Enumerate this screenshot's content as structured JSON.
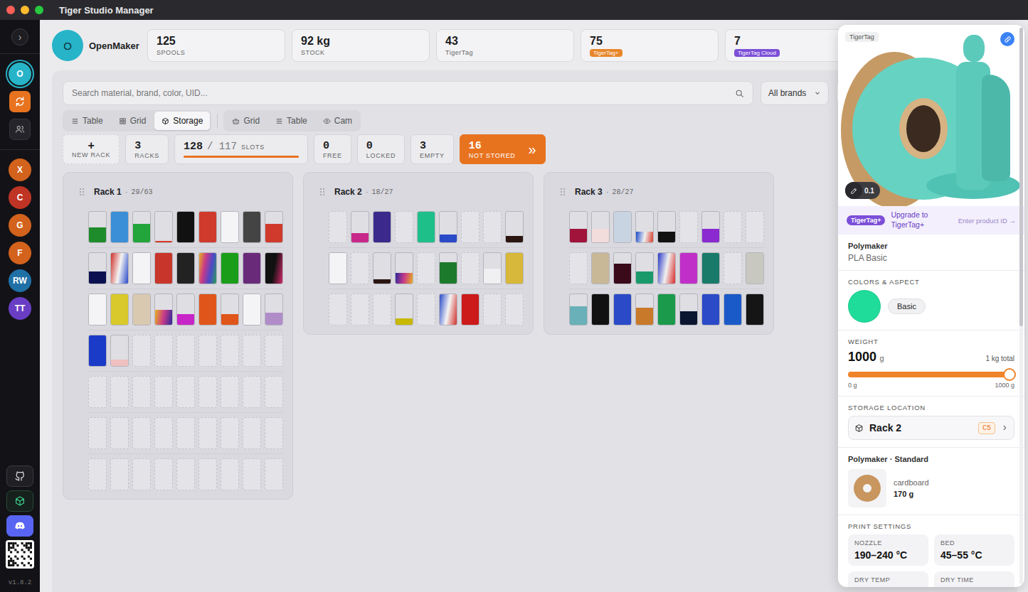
{
  "window": {
    "title": "Tiger Studio Manager"
  },
  "sidebar": {
    "toggle": "›",
    "top": [
      {
        "kind": "avatar",
        "label": "O",
        "color": "#27b3c8",
        "selected": true
      },
      {
        "kind": "sync",
        "color": "#e8731f",
        "selected": false
      },
      {
        "kind": "users",
        "selected": false
      }
    ],
    "accounts": [
      {
        "label": "X",
        "color": "#d2621c",
        "selected": false
      },
      {
        "label": "C",
        "color": "#bf3424",
        "selected": false
      },
      {
        "label": "G",
        "color": "#d2621c",
        "selected": false
      },
      {
        "label": "F",
        "color": "#d2621c",
        "selected": false
      },
      {
        "label": "RW",
        "color": "#1f70a6",
        "selected": false
      },
      {
        "label": "TT",
        "color": "#6a3ec4",
        "selected": false
      }
    ],
    "bottom": [
      {
        "kind": "github"
      },
      {
        "kind": "cube"
      },
      {
        "kind": "discord"
      },
      {
        "kind": "qr"
      }
    ],
    "version": "v1.8.2"
  },
  "header": {
    "avatar": "O",
    "name": "OpenMaker",
    "stats": [
      {
        "kind": "plain",
        "value": "125",
        "label": "SPOOLS"
      },
      {
        "kind": "plain",
        "value": "92 kg",
        "label": "STOCK"
      },
      {
        "kind": "plain",
        "value": "43",
        "label": "TigerTag"
      },
      {
        "kind": "badge",
        "value": "75",
        "label": "TigerTag+",
        "color": "#e8862a"
      },
      {
        "kind": "badge",
        "value": "7",
        "label": "TigerTag Cloud",
        "color": "#7c4fd8"
      }
    ]
  },
  "search": {
    "placeholder": "Search material, brand, color, UID...",
    "brand_filter": "All brands"
  },
  "view_tabs": [
    [
      {
        "kind": "list",
        "label": "Table",
        "selected": false
      },
      {
        "kind": "grid",
        "label": "Grid",
        "selected": false
      },
      {
        "kind": "cube",
        "label": "Storage",
        "selected": true
      }
    ],
    [
      {
        "kind": "basket",
        "label": "Grid",
        "selected": false
      },
      {
        "kind": "list",
        "label": "Table",
        "selected": false
      },
      {
        "kind": "eye",
        "label": "Cam",
        "selected": false
      }
    ]
  ],
  "storage_stats": {
    "new_rack": {
      "icon": "+",
      "label": "NEW RACK"
    },
    "items": [
      {
        "kind": "plain",
        "value": "3",
        "label": "RACKS"
      },
      {
        "kind": "meter",
        "value": "128",
        "total": "/ 117",
        "label": "SLOTS",
        "level": 1
      },
      {
        "kind": "plain",
        "value": "0",
        "label": "FREE"
      },
      {
        "kind": "plain",
        "value": "0",
        "label": "LOCKED"
      },
      {
        "kind": "plain",
        "value": "3",
        "label": "EMPTY"
      },
      {
        "kind": "alert",
        "value": "16",
        "label": "NOT STORED",
        "icon": "»"
      }
    ]
  },
  "racks": {
    "separator": "·",
    "items": [
      {
        "name": "Rack 1",
        "count": "29/63",
        "rows": [
          [
            {
              "kind": "spool",
              "color": "#1e8c2a",
              "level": 0.5
            },
            {
              "kind": "spool",
              "color": "#3a8fd6",
              "level": 1
            },
            {
              "kind": "spool",
              "color": "#22a53a",
              "level": 0.6
            },
            {
              "kind": "spool",
              "color": "#d83a2a",
              "level": 0.05
            },
            {
              "kind": "spool",
              "color": "#111111",
              "level": 1
            },
            {
              "kind": "spool",
              "color": "#d03a2d",
              "level": 1
            },
            {
              "kind": "spool",
              "color": "#f4f4f6",
              "level": 1
            },
            {
              "kind": "spool",
              "color": "#444444",
              "level": 1
            },
            {
              "kind": "spool",
              "color": "#d03a2d",
              "level": 0.6
            }
          ],
          [
            {
              "kind": "spool",
              "color": "#0a1050",
              "level": 0.4
            },
            {
              "kind": "multi",
              "colors": [
                "#d0302a",
                "#f4f4f4",
                "#2a4ac8"
              ],
              "level": 1
            },
            {
              "kind": "spool",
              "color": "#f4f4f6",
              "level": 1
            },
            {
              "kind": "spool",
              "color": "#c8352b",
              "level": 1
            },
            {
              "kind": "spool",
              "color": "#222222",
              "level": 1
            },
            {
              "kind": "multi",
              "colors": [
                "#e8b020",
                "#c83a8a",
                "#4a4ac8",
                "#2aa05a"
              ],
              "level": 1
            },
            {
              "kind": "spool",
              "color": "#1a9e1a",
              "level": 1
            },
            {
              "kind": "spool",
              "color": "#6a2a7a",
              "level": 1
            },
            {
              "kind": "multi",
              "colors": [
                "#111111",
                "#111111",
                "#d02a6a"
              ],
              "level": 1
            }
          ],
          [
            {
              "kind": "spool",
              "color": "#f4f4f6",
              "level": 1
            },
            {
              "kind": "spool",
              "color": "#d9c92a",
              "level": 1
            },
            {
              "kind": "spool",
              "color": "#d8c9b0",
              "level": 1
            },
            {
              "kind": "multi",
              "colors": [
                "#e8b020",
                "#c83a8a",
                "#2a2a9a"
              ],
              "level": 0.5
            },
            {
              "kind": "spool",
              "color": "#c825c8",
              "level": 0.35
            },
            {
              "kind": "spool",
              "color": "#e0561a",
              "level": 1
            },
            {
              "kind": "spool",
              "color": "#e0561a",
              "level": 0.35
            },
            {
              "kind": "spool",
              "color": "#f4f4f6",
              "level": 1
            },
            {
              "kind": "spool",
              "color": "#b08cc8",
              "level": 0.4
            }
          ],
          [
            {
              "kind": "spool",
              "color": "#1a3ac8",
              "level": 1
            },
            {
              "kind": "spool",
              "color": "#f0c0c0",
              "level": 0.2
            },
            {
              "kind": "empty"
            },
            {
              "kind": "empty"
            },
            {
              "kind": "empty"
            },
            {
              "kind": "empty"
            },
            {
              "kind": "empty"
            },
            {
              "kind": "empty"
            },
            {
              "kind": "empty"
            }
          ],
          [
            {
              "kind": "empty"
            },
            {
              "kind": "empty"
            },
            {
              "kind": "empty"
            },
            {
              "kind": "empty"
            },
            {
              "kind": "empty"
            },
            {
              "kind": "empty"
            },
            {
              "kind": "empty"
            },
            {
              "kind": "empty"
            },
            {
              "kind": "empty"
            }
          ],
          [
            {
              "kind": "empty"
            },
            {
              "kind": "empty"
            },
            {
              "kind": "empty"
            },
            {
              "kind": "empty"
            },
            {
              "kind": "empty"
            },
            {
              "kind": "empty"
            },
            {
              "kind": "empty"
            },
            {
              "kind": "empty"
            },
            {
              "kind": "empty"
            }
          ],
          [
            {
              "kind": "empty"
            },
            {
              "kind": "empty"
            },
            {
              "kind": "empty"
            },
            {
              "kind": "empty"
            },
            {
              "kind": "empty"
            },
            {
              "kind": "empty"
            },
            {
              "kind": "empty"
            },
            {
              "kind": "empty"
            },
            {
              "kind": "empty"
            }
          ]
        ]
      },
      {
        "name": "Rack 2",
        "count": "18/27",
        "rows": [
          [
            {
              "kind": "empty"
            },
            {
              "kind": "spool",
              "color": "#c8288a",
              "level": 0.3
            },
            {
              "kind": "spool",
              "color": "#3b2a8c",
              "level": 1
            },
            {
              "kind": "empty"
            },
            {
              "kind": "spool",
              "color": "#1fbf8a",
              "level": 1
            },
            {
              "kind": "spool",
              "color": "#2a4ac8",
              "level": 0.25
            },
            {
              "kind": "empty"
            },
            {
              "kind": "empty"
            },
            {
              "kind": "spool",
              "color": "#2a1510",
              "level": 0.2
            }
          ],
          [
            {
              "kind": "spool",
              "color": "#f4f4f6",
              "level": 1
            },
            {
              "kind": "empty"
            },
            {
              "kind": "spool",
              "color": "#2a1510",
              "level": 0.15
            },
            {
              "kind": "multi",
              "colors": [
                "#2a2a9a",
                "#c83a8a",
                "#e8b020"
              ],
              "level": 0.35
            },
            {
              "kind": "empty"
            },
            {
              "kind": "spool",
              "color": "#1c7a2c",
              "level": 0.7
            },
            {
              "kind": "empty"
            },
            {
              "kind": "spool",
              "color": "#f0f0f2",
              "level": 0.5
            },
            {
              "kind": "spool",
              "color": "#d8b83a",
              "level": 1
            }
          ],
          [
            {
              "kind": "empty"
            },
            {
              "kind": "empty"
            },
            {
              "kind": "empty"
            },
            {
              "kind": "spool",
              "color": "#c8b800",
              "level": 0.2
            },
            {
              "kind": "empty"
            },
            {
              "kind": "multi",
              "colors": [
                "#2a4ac8",
                "#f4f4f4",
                "#d0302a"
              ],
              "level": 1
            },
            {
              "kind": "spool",
              "color": "#cc1a1a",
              "level": 1
            },
            {
              "kind": "empty"
            },
            {
              "kind": "empty"
            }
          ]
        ]
      },
      {
        "name": "Rack 3",
        "count": "28/27",
        "rows": [
          [
            {
              "kind": "spool",
              "color": "#a0143c",
              "level": 0.45
            },
            {
              "kind": "spool",
              "color": "#f2dcdc",
              "level": 0.45
            },
            {
              "kind": "spool",
              "color": "#c8d4e2",
              "level": 1
            },
            {
              "kind": "multi",
              "colors": [
                "#1a4ac8",
                "#f0f0f0",
                "#d83a2a"
              ],
              "level": 0.35
            },
            {
              "kind": "spool",
              "color": "#111111",
              "level": 0.35
            },
            {
              "kind": "empty"
            },
            {
              "kind": "spool",
              "color": "#8a2ad0",
              "level": 0.45
            },
            {
              "kind": "empty"
            },
            {
              "kind": "empty"
            }
          ],
          [
            {
              "kind": "empty"
            },
            {
              "kind": "spool",
              "color": "#c8b898",
              "level": 1
            },
            {
              "kind": "spool",
              "color": "#3a0a1a",
              "level": 0.65
            },
            {
              "kind": "spool",
              "color": "#1a9a6a",
              "level": 0.4
            },
            {
              "kind": "multi",
              "colors": [
                "#2a3ac8",
                "#f0f0f0",
                "#d82a2a"
              ],
              "level": 1
            },
            {
              "kind": "spool",
              "color": "#c030c8",
              "level": 1
            },
            {
              "kind": "spool",
              "color": "#1a7a6a",
              "level": 1
            },
            {
              "kind": "empty"
            },
            {
              "kind": "spool",
              "color": "#c8c8c0",
              "level": 1
            }
          ],
          [
            {
              "kind": "spool",
              "color": "#6ab0b8",
              "level": 0.6
            },
            {
              "kind": "spool",
              "color": "#111111",
              "level": 1
            },
            {
              "kind": "spool",
              "color": "#2a4ac8",
              "level": 1
            },
            {
              "kind": "spool",
              "color": "#c87a2a",
              "level": 0.55
            },
            {
              "kind": "spool",
              "color": "#1a9a4a",
              "level": 1
            },
            {
              "kind": "spool",
              "color": "#0a1530",
              "level": 0.45
            },
            {
              "kind": "spool",
              "color": "#2a4ac8",
              "level": 1
            },
            {
              "kind": "spool",
              "color": "#1a5ac8",
              "level": 1
            },
            {
              "kind": "spool",
              "color": "#151515",
              "level": 1
            }
          ]
        ]
      }
    ]
  },
  "detail_panel": {
    "source_tag": "TigerTag",
    "edit_badge": "0.1",
    "upgrade": {
      "badge": "TigerTag+",
      "text": "Upgrade to TigerTag+",
      "action": "Enter product ID →"
    },
    "product": {
      "brand": "Polymaker",
      "name": "PLA Basic"
    },
    "colors": {
      "heading": "COLORS & ASPECT",
      "swatch": "#1fdc9a",
      "aspect": "Basic"
    },
    "weight": {
      "heading": "WEIGHT",
      "value": "1000",
      "unit": "g",
      "total": "1 kg total",
      "level": 1,
      "min": "0 g",
      "max": "1000 g"
    },
    "storage_location": {
      "heading": "STORAGE LOCATION",
      "rack": "Rack 2",
      "slot": "C5"
    },
    "spool": {
      "title": "Polymaker · Standard",
      "material": "cardboard",
      "weight": "170 g"
    },
    "print_settings": {
      "heading": "PRINT SETTINGS",
      "items": [
        {
          "label": "NOZZLE",
          "value": "190–240 °C"
        },
        {
          "label": "BED",
          "value": "45–55 °C"
        },
        {
          "label": "DRY TEMP"
        },
        {
          "label": "DRY TIME"
        }
      ]
    }
  }
}
